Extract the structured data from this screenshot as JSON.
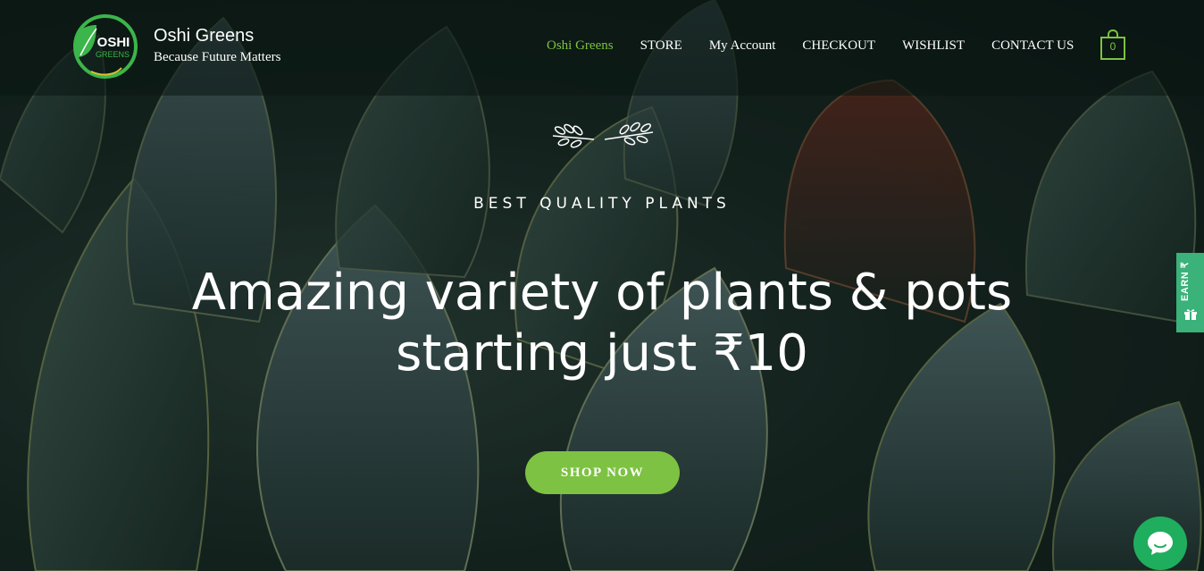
{
  "brand": {
    "logo_text_top": "OSHI",
    "logo_text_bottom": "GREENS",
    "name": "Oshi Greens",
    "tagline": "Because Future Matters"
  },
  "nav": {
    "items": [
      {
        "label": "Oshi Greens",
        "active": true
      },
      {
        "label": "STORE",
        "active": false
      },
      {
        "label": "My Account",
        "active": false
      },
      {
        "label": "CHECKOUT",
        "active": false
      },
      {
        "label": "WISHLIST",
        "active": false
      },
      {
        "label": "CONTACT US",
        "active": false
      }
    ],
    "cart_count": "0",
    "cart_icon": "shopping-bag-icon"
  },
  "hero": {
    "ornament_icon": "laurel-divider-icon",
    "eyebrow": "BEST QUALITY PLANTS",
    "headline": "Amazing variety of plants & pots starting just ₹10",
    "cta_label": "SHOP NOW"
  },
  "side_tab": {
    "label": "EARN ₹",
    "icon": "gift-icon"
  },
  "chat": {
    "icon": "chat-bubble-icon"
  },
  "colors": {
    "accent": "#7dc242",
    "side_tab": "#3ab279",
    "chat": "#1fae5e",
    "text": "#ffffff"
  }
}
